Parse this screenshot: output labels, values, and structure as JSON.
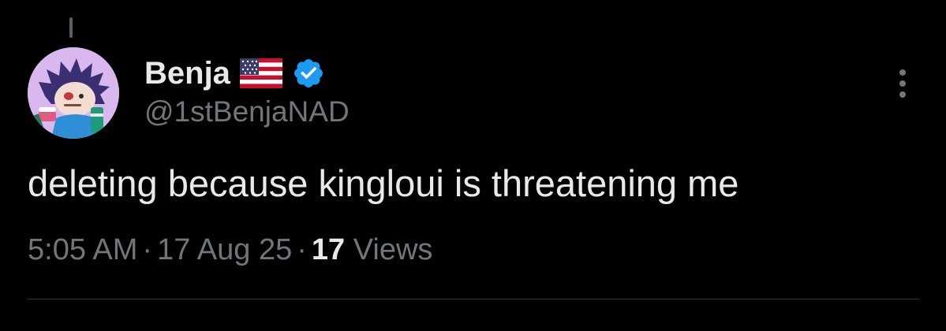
{
  "post": {
    "author": {
      "display_name": "Benja",
      "handle": "@1stBenjaNAD",
      "flag_icon": "us-flag-icon",
      "verified_icon": "verified-badge-icon",
      "avatar_icon": "avatar-image"
    },
    "text": "deleting because kingloui is threatening me",
    "time": "5:05 AM",
    "date": "17 Aug 25",
    "separator": "·",
    "views_count": "17",
    "views_label": "Views",
    "more_icon": "more-options-icon"
  },
  "colors": {
    "background": "#000000",
    "primary_text": "#e7e9ea",
    "secondary_text": "#71767b",
    "verified_blue": "#1d9bf0",
    "divider": "#2f3336"
  }
}
